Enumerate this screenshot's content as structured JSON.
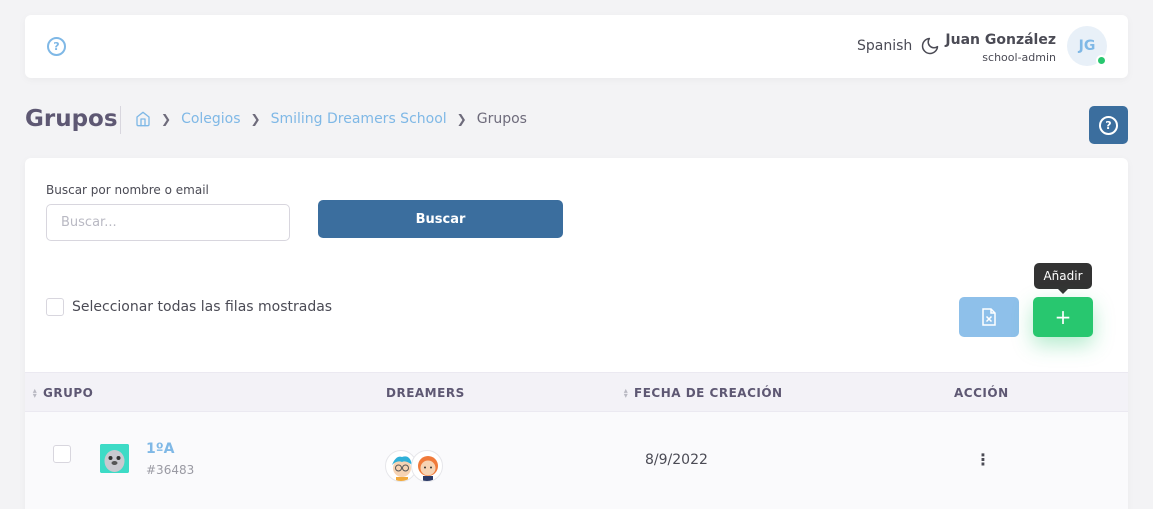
{
  "topbar": {
    "language": "Spanish",
    "user": {
      "name": "Juan González",
      "role": "school-admin",
      "initials": "JG"
    }
  },
  "page": {
    "title": "Grupos",
    "breadcrumb": [
      {
        "label": "Colegios"
      },
      {
        "label": "Smiling Dreamers School"
      },
      {
        "label": "Grupos"
      }
    ]
  },
  "search": {
    "label": "Buscar por nombre o email",
    "placeholder": "Buscar...",
    "button": "Buscar"
  },
  "select_all_label": "Seleccionar todas las filas mostradas",
  "add_tooltip": "Añadir",
  "add_symbol": "+",
  "table": {
    "headers": {
      "group": "GRUPO",
      "dreamers": "DREAMERS",
      "created": "FECHA DE CREACIÓN",
      "action": "ACCIÓN"
    },
    "rows": [
      {
        "name": "1ºA",
        "id": "#36483",
        "created": "8/9/2022"
      }
    ]
  },
  "colors": {
    "primary": "#3b6e9e",
    "link": "#7fb8e6",
    "success": "#28c76f",
    "excel": "#8ec0ea"
  }
}
